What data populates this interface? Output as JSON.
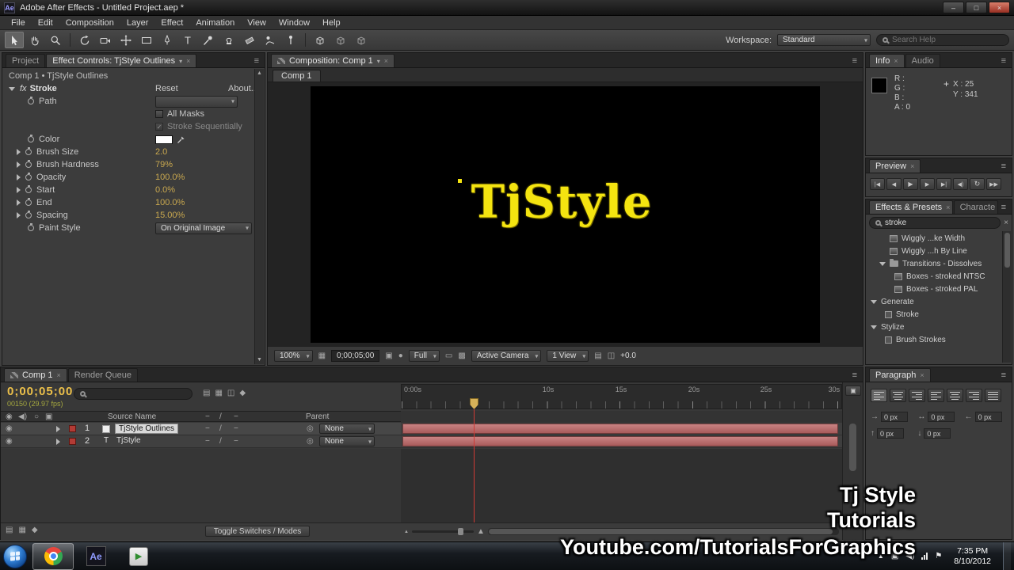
{
  "icons": {
    "minimize": "–",
    "maximize": "□",
    "close": "×",
    "menu": "≡",
    "chevron": "▾",
    "eye": "◉",
    "speaker": "◀)",
    "solo": "○",
    "lock": "▣",
    "pickwhip": "◎",
    "dash": "−",
    "slash": "/",
    "text_layer": "T",
    "up_arrow": "▲",
    "down_arrow": "▼",
    "flag": "⚑",
    "play": "▶",
    "snapshot": "▣",
    "channels": "●",
    "safe_guides": "▦",
    "roi": "▭",
    "grid": "▩",
    "view_layout": "▤",
    "ratio": "◫",
    "film": "▤",
    "blend": "▦",
    "motion_blur": "◫",
    "graph": "◆",
    "mountain": "▲",
    "arrow_right": "→",
    "arrow_left": "←",
    "arrow_up": "↑",
    "arrow_down": "↓",
    "arrow_both": "↔"
  },
  "titlebar": {
    "app_initials": "Ae",
    "title": "Adobe After Effects - Untitled Project.aep *"
  },
  "menubar": {
    "items": [
      "File",
      "Edit",
      "Composition",
      "Layer",
      "Effect",
      "Animation",
      "View",
      "Window",
      "Help"
    ]
  },
  "toolbar": {
    "workspace_label": "Workspace:",
    "workspace_value": "Standard",
    "search_placeholder": "Search Help"
  },
  "effect_controls": {
    "tab_project": "Project",
    "tab_effects": "Effect Controls: TjStyle Outlines",
    "breadcrumb": "Comp 1 • TjStyle Outlines",
    "effect": {
      "fx_badge": "fx",
      "name": "Stroke",
      "reset_label": "Reset",
      "about_label": "About..."
    },
    "rows": {
      "path_label": "Path",
      "path_value": "",
      "all_masks_label": "All Masks",
      "stroke_seq_label": "Stroke Sequentially",
      "color_label": "Color",
      "brush_size_label": "Brush Size",
      "brush_size_value": "2.0",
      "brush_hardness_label": "Brush Hardness",
      "brush_hardness_value": "79%",
      "opacity_label": "Opacity",
      "opacity_value": "100.0%",
      "start_label": "Start",
      "start_value": "0.0%",
      "end_label": "End",
      "end_value": "100.0%",
      "spacing_label": "Spacing",
      "spacing_value": "15.00%",
      "paint_style_label": "Paint Style",
      "paint_style_value": "On Original Image"
    }
  },
  "composition": {
    "tab": "Composition: Comp 1",
    "comp_tab": "Comp 1",
    "canvas_text": "TjStyle",
    "zoom": "100%",
    "timecode": "0;00;05;00",
    "resolution": "Full",
    "camera": "Active Camera",
    "views": "1 View",
    "exposure": "+0.0"
  },
  "info_panel": {
    "tab_info": "Info",
    "tab_audio": "Audio",
    "channels": [
      {
        "label": "R :",
        "value": ""
      },
      {
        "label": "G :",
        "value": ""
      },
      {
        "label": "B :",
        "value": ""
      },
      {
        "label": "A :",
        "value": "0"
      }
    ],
    "x_label": "X : 25",
    "y_label": "Y : 341"
  },
  "preview_panel": {
    "tab": "Preview",
    "buttons": [
      "|◀",
      "◀",
      "▶",
      "▶",
      "▶|",
      "◀)",
      "↻",
      "▶▶"
    ]
  },
  "effects_presets": {
    "tab": "Effects & Presets",
    "tab_character": "Characte",
    "search_value": "stroke",
    "items": [
      {
        "label": "Wiggly ...ke Width",
        "type": "preset"
      },
      {
        "label": "Wiggly ...h By Line",
        "type": "preset"
      },
      {
        "label": "Transitions - Dissolves",
        "type": "folder"
      },
      {
        "label": "Boxes - stroked NTSC",
        "type": "effect"
      },
      {
        "label": "Boxes - stroked PAL",
        "type": "effect"
      },
      {
        "label": "Generate",
        "type": "folder"
      },
      {
        "label": "Stroke",
        "type": "effect"
      },
      {
        "label": "Stylize",
        "type": "folder"
      },
      {
        "label": "Brush Strokes",
        "type": "effect"
      }
    ]
  },
  "paragraph_panel": {
    "tab": "Paragraph",
    "fields": [
      "0 px",
      "0 px",
      "0 px",
      "0 px",
      "0 px"
    ]
  },
  "timeline": {
    "tab_comp": "Comp 1",
    "tab_render_queue": "Render Queue",
    "timecode": "0;00;05;00",
    "frame_info": "00150 (29.97 fps)",
    "col_source_name": "Source Name",
    "col_parent": "Parent",
    "layers": [
      {
        "num": "1",
        "name": "TjStyle Outlines",
        "parent": "None"
      },
      {
        "num": "2",
        "name": "TjStyle",
        "parent": "None"
      }
    ],
    "ruler_labels": [
      "0:00s",
      "10s",
      "15s",
      "20s",
      "25s",
      "30s"
    ],
    "toggle_label": "Toggle Switches / Modes"
  },
  "watermark": {
    "line1": "Tj Style",
    "line2": "Tutorials",
    "line3": "Youtube.com/TutorialsForGraphics"
  },
  "taskbar": {
    "clock_time": "7:35 PM",
    "clock_date": "8/10/2012"
  }
}
